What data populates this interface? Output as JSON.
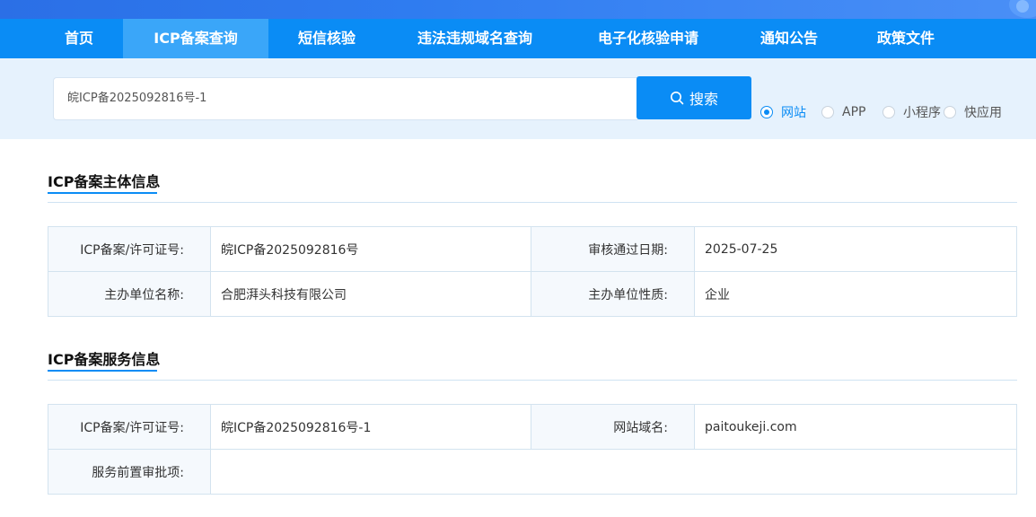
{
  "nav": {
    "items": [
      {
        "label": "首页",
        "active": false
      },
      {
        "label": "ICP备案查询",
        "active": true
      },
      {
        "label": "短信核验",
        "active": false
      },
      {
        "label": "违法违规域名查询",
        "active": false
      },
      {
        "label": "电子化核验申请",
        "active": false
      },
      {
        "label": "通知公告",
        "active": false
      },
      {
        "label": "政策文件",
        "active": false
      }
    ]
  },
  "search": {
    "value": "皖ICP备2025092816号-1",
    "button_label": "搜索",
    "options": [
      {
        "label": "网站",
        "checked": true
      },
      {
        "label": "APP",
        "checked": false
      },
      {
        "label": "小程序",
        "checked": false
      },
      {
        "label": "快应用",
        "checked": false
      }
    ]
  },
  "subject": {
    "title": "ICP备案主体信息",
    "license_label": "ICP备案/许可证号:",
    "license_value": "皖ICP备2025092816号",
    "approve_date_label": "审核通过日期:",
    "approve_date_value": "2025-07-25",
    "org_name_label": "主办单位名称:",
    "org_name_value": "合肥湃头科技有限公司",
    "org_type_label": "主办单位性质:",
    "org_type_value": "企业"
  },
  "service": {
    "title": "ICP备案服务信息",
    "license_label": "ICP备案/许可证号:",
    "license_value": "皖ICP备2025092816号-1",
    "domain_label": "网站域名:",
    "domain_value": "paitoukeji.com",
    "pre_approval_label": "服务前置审批项:",
    "pre_approval_value": ""
  },
  "colors": {
    "nav_bg": "#0a8cf5",
    "nav_active": "#3aa6f9",
    "search_band": "#e6f2fd",
    "accent": "#0a8cf5"
  }
}
